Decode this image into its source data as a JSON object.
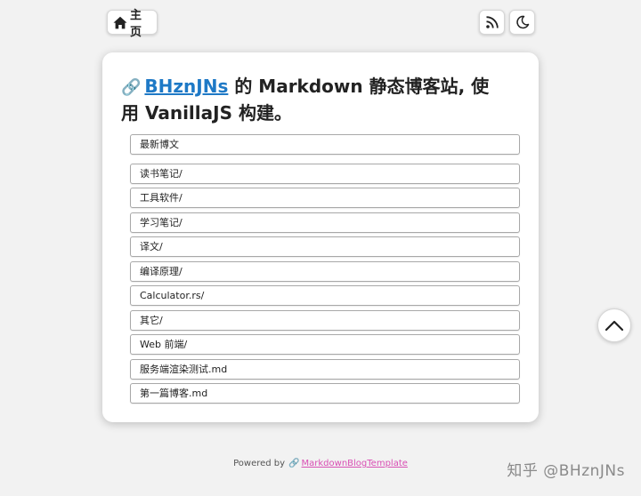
{
  "nav": {
    "home_label": "主页"
  },
  "header": {
    "title_link": "BHznJNs",
    "title_text": " 的 Markdown 静态博客站, 使用 VanillaJS 构建。"
  },
  "list": {
    "latest_label": "最新博文",
    "items": [
      "读书笔记/",
      "工具软件/",
      "学习笔记/",
      "译文/",
      "编译原理/",
      "Calculator.rs/",
      "其它/",
      "Web 前端/",
      "服务端渲染测试.md",
      "第一篇博客.md"
    ]
  },
  "footer": {
    "powered_by": "Powered by",
    "template_link": "MarkdownBlogTemplate"
  },
  "watermark": {
    "text": "知乎 @BHznJNs"
  },
  "colors": {
    "link": "#1e79c6",
    "footer_link": "#d94fb4"
  }
}
